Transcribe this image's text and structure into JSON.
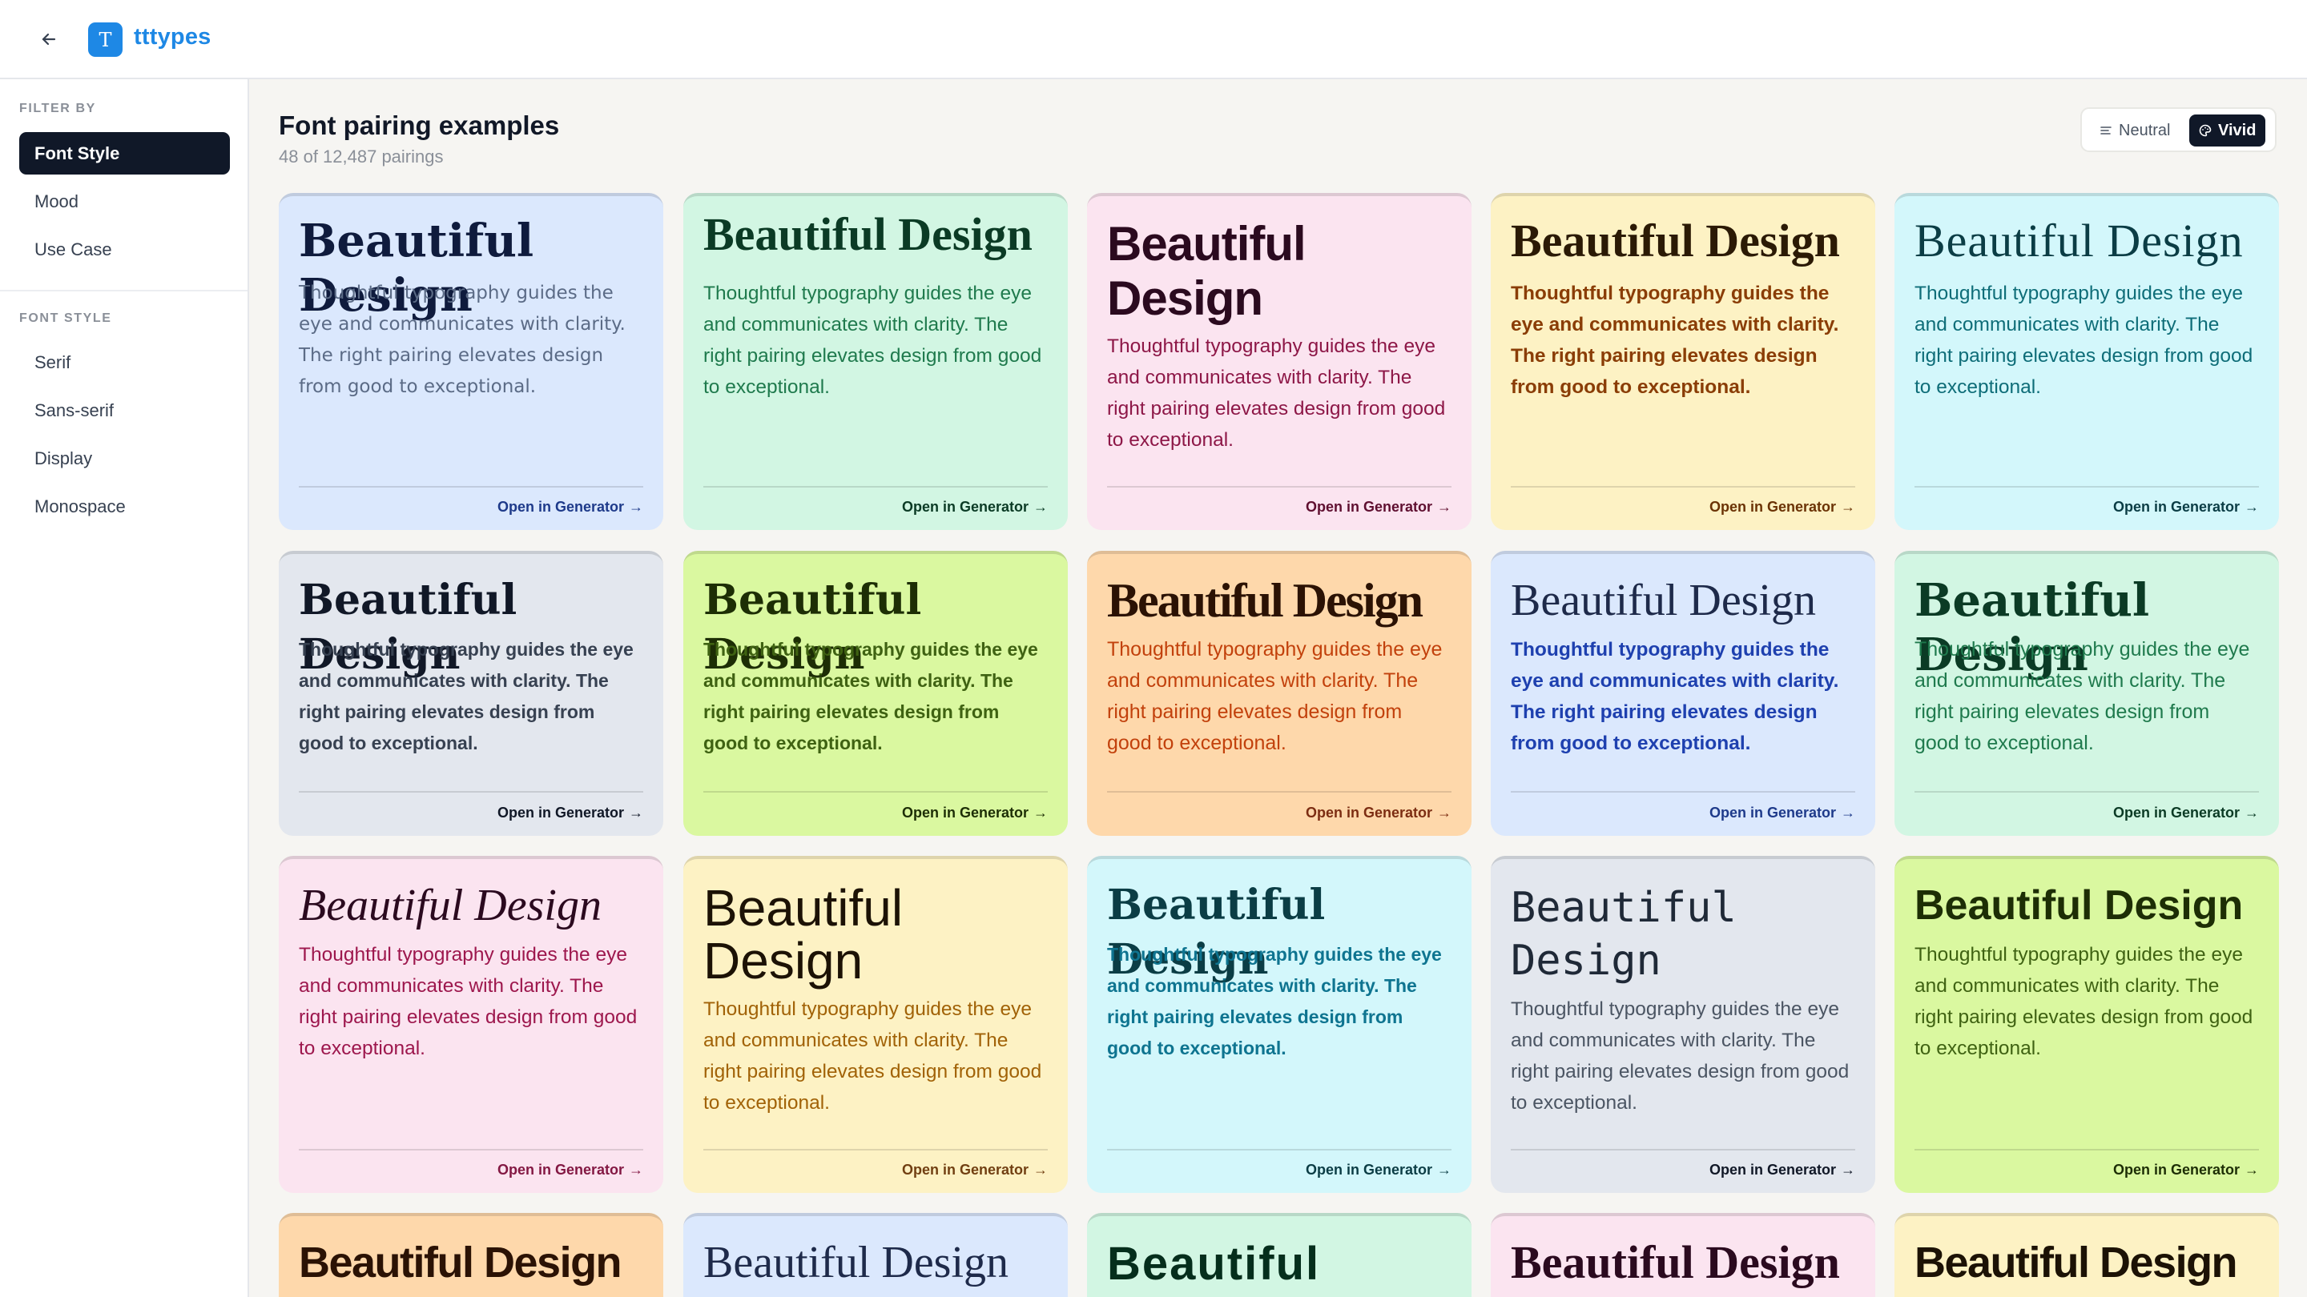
{
  "header": {
    "app_name": "tttypes",
    "logo_letter": "T"
  },
  "sidebar": {
    "filter_heading": "FILTER BY",
    "filters": [
      "Font Style",
      "Mood",
      "Use Case"
    ],
    "style_heading": "FONT STYLE",
    "styles": [
      "Serif",
      "Sans-serif",
      "Display",
      "Monospace"
    ]
  },
  "main": {
    "title": "Font pairing examples",
    "subtitle": "48 of 12,487 pairings",
    "toggle": {
      "neutral": "Neutral",
      "vivid": "Vivid"
    }
  },
  "card_text": {
    "heading": "Beautiful Design",
    "body": "Thoughtful typography guides the eye and communicates with clarity. The right pairing elevates design from good to exceptional.",
    "link": "Open in Generator",
    "heading_partial": "Beautiful"
  },
  "colors": {
    "brand": "#1e88e5",
    "blue": "#dbe8fd",
    "green": "#d2f6e3",
    "pink": "#fbe4f0",
    "yellow": "#fdf2c4",
    "cyan": "#d3f7fb",
    "slate": "#e3e7ee",
    "lime": "#daf8a0",
    "orange": "#fed8ab"
  }
}
